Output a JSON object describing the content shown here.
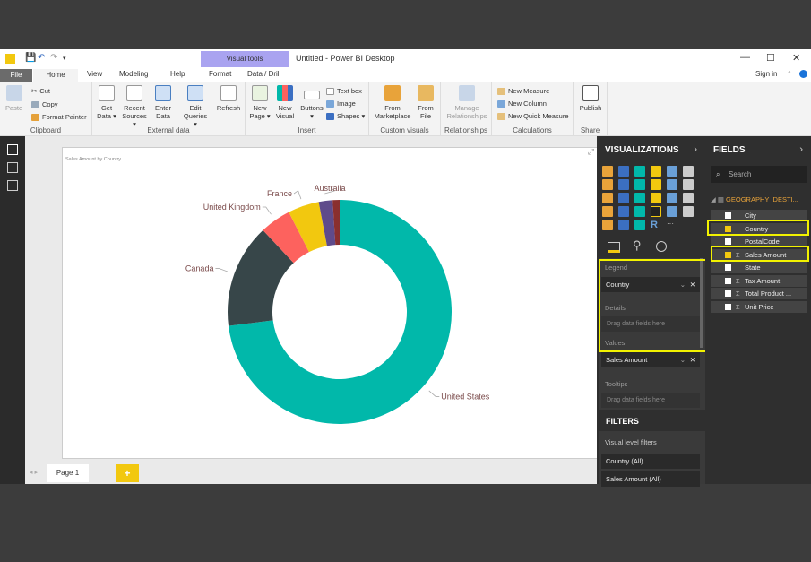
{
  "window": {
    "title": "Untitled - Power BI Desktop",
    "context_tab": "Visual tools",
    "sign_in": "Sign in"
  },
  "tabs": [
    "File",
    "Home",
    "View",
    "Modeling",
    "Help",
    "Format",
    "Data / Drill"
  ],
  "ribbon": {
    "clipboard": {
      "label": "Clipboard",
      "paste": "Paste",
      "cut": "Cut",
      "copy": "Copy",
      "format_painter": "Format Painter"
    },
    "external": {
      "label": "External data",
      "get_data": "Get Data ▾",
      "recent": "Recent Sources ▾",
      "enter": "Enter Data",
      "edit": "Edit Queries ▾",
      "refresh": "Refresh"
    },
    "insert": {
      "label": "Insert",
      "new_page": "New Page ▾",
      "new_visual": "New Visual",
      "buttons": "Buttons ▾",
      "text_box": "Text box",
      "image": "Image",
      "shapes": "Shapes ▾"
    },
    "custom": {
      "label": "Custom visuals",
      "marketplace": "From Marketplace",
      "file": "From File"
    },
    "relationships": {
      "label": "Relationships",
      "manage": "Manage Relationships"
    },
    "calculations": {
      "label": "Calculations",
      "new_measure": "New Measure",
      "new_column": "New Column",
      "quick_measure": "New Quick Measure"
    },
    "share": {
      "label": "Share",
      "publish": "Publish"
    }
  },
  "report": {
    "visual_title": "Sales Amount by Country",
    "page_tab": "Page 1",
    "add_page": "+"
  },
  "chart_data": {
    "type": "pie",
    "subtype": "donut",
    "title": "Sales Amount by Country",
    "slices": [
      {
        "name": "United States",
        "value": 73,
        "color": "#01b8aa"
      },
      {
        "name": "Canada",
        "value": 15,
        "color": "#374649"
      },
      {
        "name": "United Kingdom",
        "value": 4.5,
        "color": "#fd625e"
      },
      {
        "name": "France",
        "value": 4.5,
        "color": "#f2c80f"
      },
      {
        "name": "Australia",
        "value": 2,
        "color": "#5f4b8b"
      },
      {
        "name": "",
        "value": 1,
        "color": "#8a2f2f"
      }
    ]
  },
  "visualizations": {
    "header": "VISUALIZATIONS",
    "wells": {
      "legend": "Legend",
      "legend_field": "Country",
      "details": "Details",
      "details_placeholder": "Drag data fields here",
      "values": "Values",
      "values_field": "Sales Amount",
      "tooltips": "Tooltips",
      "tooltips_placeholder": "Drag data fields here"
    }
  },
  "filters": {
    "header": "FILTERS",
    "visual_level": "Visual level filters",
    "items": [
      "Country (All)",
      "Sales Amount (All)"
    ]
  },
  "fields": {
    "header": "FIELDS",
    "search_placeholder": "Search",
    "table": "GEOGRAPHY_DESTI...",
    "items": [
      {
        "name": "City",
        "checked": false,
        "sigma": false
      },
      {
        "name": "Country",
        "checked": true,
        "sigma": false
      },
      {
        "name": "PostalCode",
        "checked": false,
        "sigma": false
      },
      {
        "name": "Sales Amount",
        "checked": true,
        "sigma": true
      },
      {
        "name": "State",
        "checked": false,
        "sigma": false
      },
      {
        "name": "Tax Amount",
        "checked": false,
        "sigma": true
      },
      {
        "name": "Total Product ...",
        "checked": false,
        "sigma": true
      },
      {
        "name": "Unit Price",
        "checked": false,
        "sigma": true
      }
    ]
  }
}
